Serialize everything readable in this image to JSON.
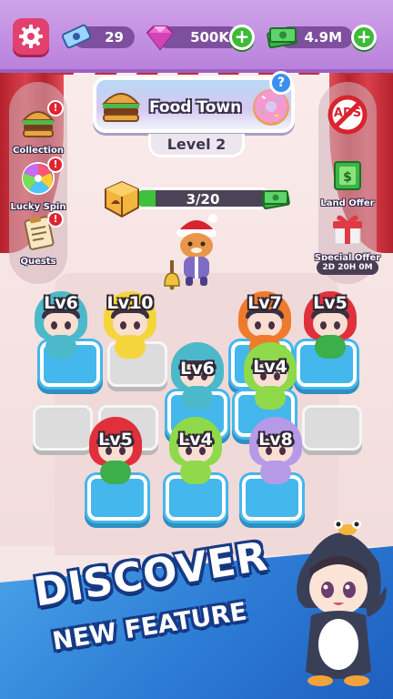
{
  "header": {
    "tickets": "29",
    "gems": "500K",
    "cash": "4.9M"
  },
  "left_panel": {
    "items": [
      {
        "label": "Collection",
        "alert": "!"
      },
      {
        "label": "Lucky Spin",
        "alert": "!"
      },
      {
        "label": "Quests",
        "alert": "!"
      }
    ]
  },
  "right_panel": {
    "ads_label": "ADS",
    "land_offer": "Land Offer",
    "special_offer": "Special Offer",
    "timer": "2D 20H 0M"
  },
  "location": {
    "name": "Food Town",
    "level": "Level 2",
    "info": "?"
  },
  "progress": {
    "text": "3/20",
    "current": 3,
    "max": 20
  },
  "units": [
    {
      "level": "Lv6"
    },
    {
      "level": "Lv10"
    },
    {
      "level": "Lv7"
    },
    {
      "level": "Lv5"
    },
    {
      "level": "Lv6"
    },
    {
      "level": "Lv4"
    },
    {
      "level": "Lv5"
    },
    {
      "level": "Lv4"
    },
    {
      "level": "Lv8"
    }
  ],
  "promo": {
    "line1": "DISCOVER",
    "line2": "NEW FEATURE"
  },
  "colors": {
    "accent_purple": "#b981dc",
    "tile_blue": "#44b7ec",
    "progress_green": "#3fc23b"
  }
}
